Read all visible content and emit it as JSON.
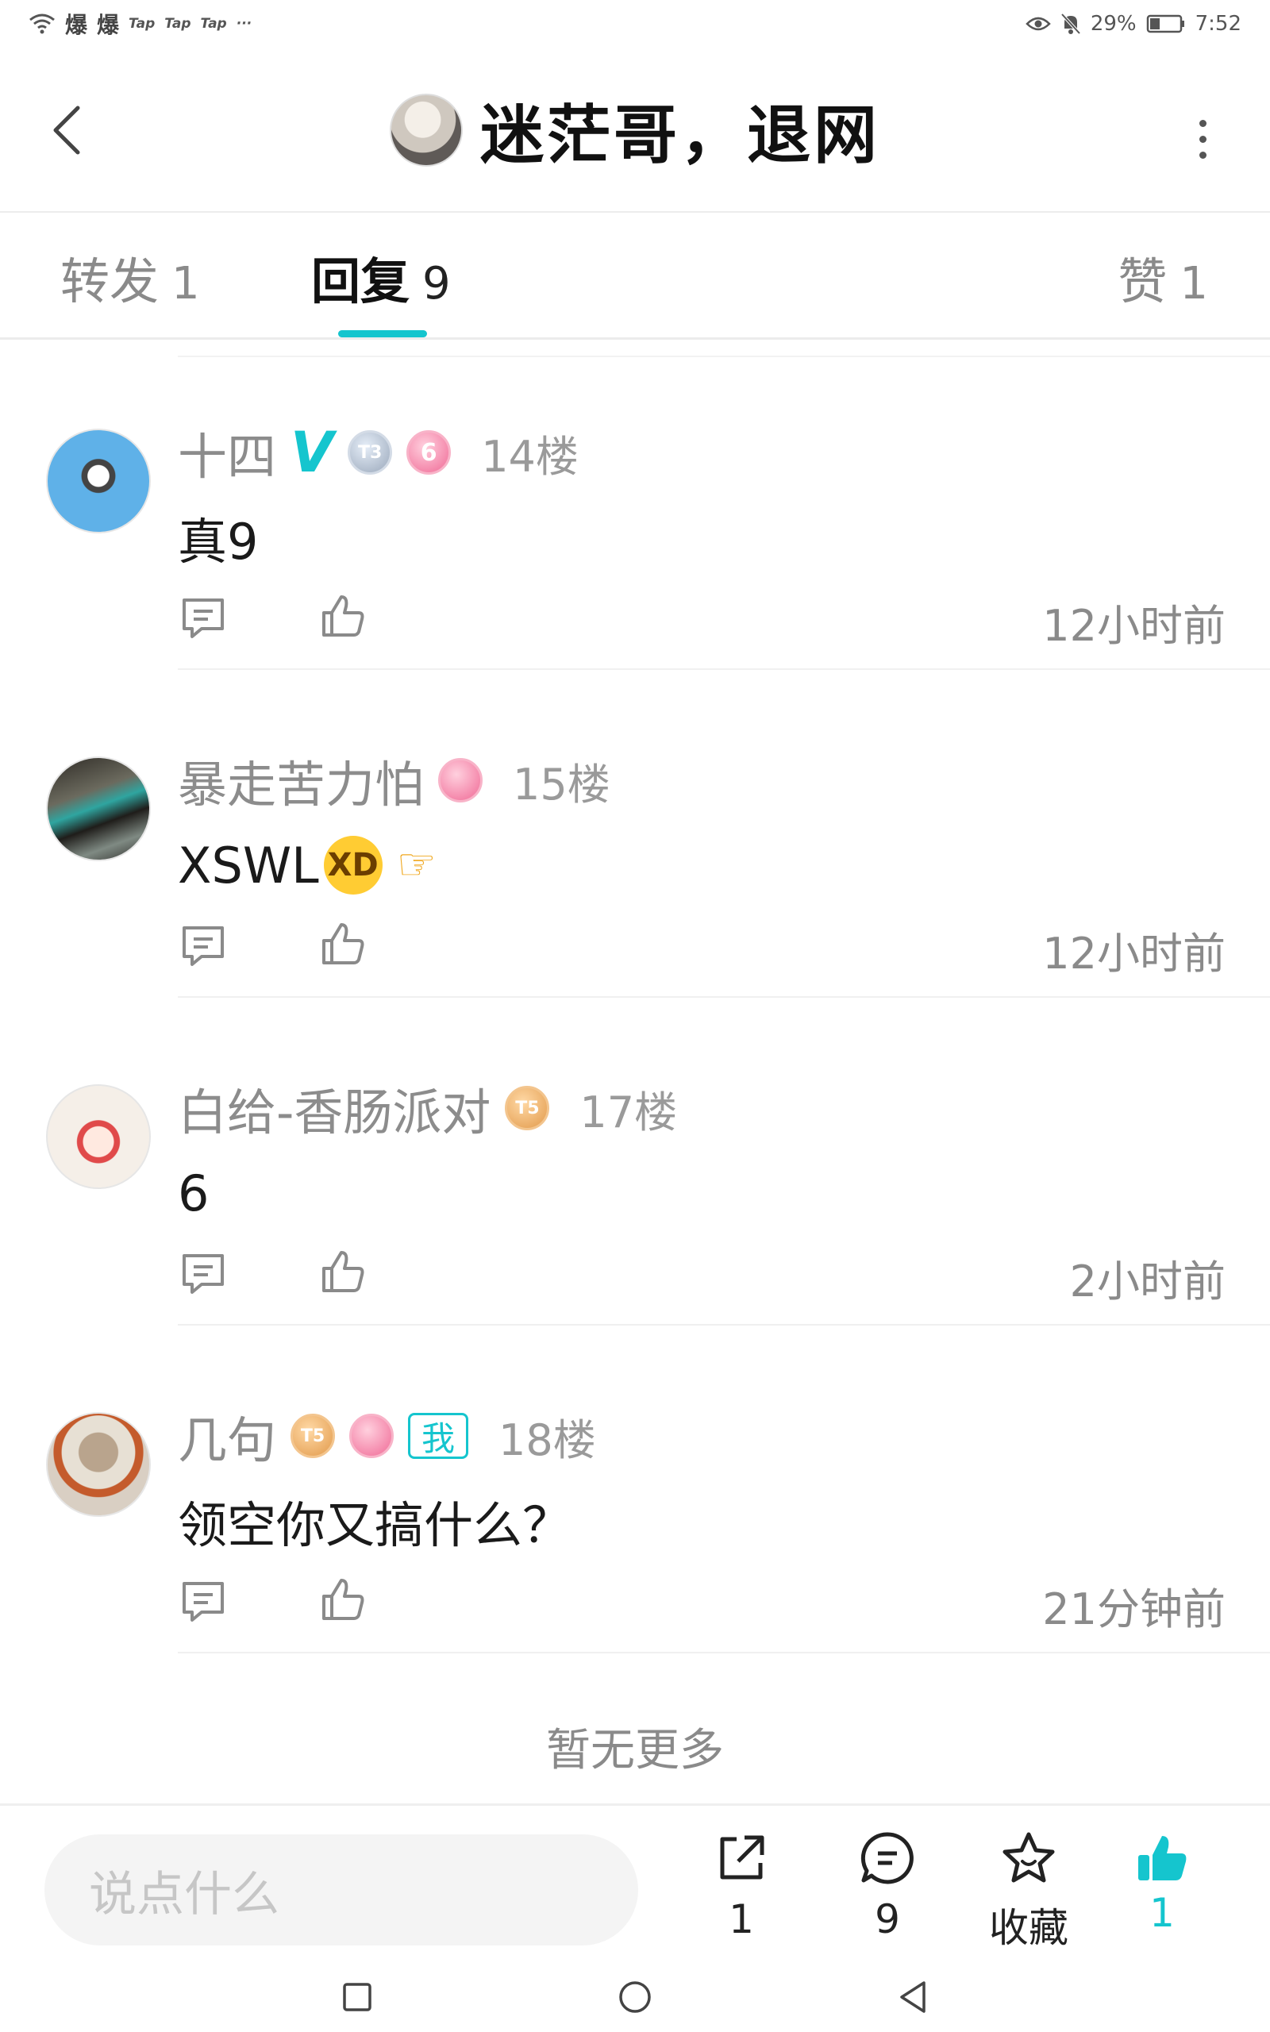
{
  "status_bar": {
    "app_icons": [
      "爆",
      "爆"
    ],
    "small_icons": [
      "Tap",
      "Tap",
      "Tap"
    ],
    "more": "···",
    "battery": "29%",
    "time": "7:52"
  },
  "header": {
    "title": "迷茫哥，退网"
  },
  "tabs": [
    {
      "label": "转发",
      "count": "1"
    },
    {
      "label": "回复",
      "count": "9"
    },
    {
      "label": "赞",
      "count": "1"
    }
  ],
  "comments": [
    {
      "user": "十四",
      "verified": "V",
      "badges": [
        "T3",
        "6"
      ],
      "floor": "14楼",
      "content": "真9",
      "time": "12小时前"
    },
    {
      "user": "暴走苦力怕",
      "badges": [
        "pink"
      ],
      "floor": "15楼",
      "content": "XSWL",
      "emojis": [
        "🤣",
        "👉"
      ],
      "time": "12小时前"
    },
    {
      "user": "白给-香肠派对",
      "badges": [
        "T5"
      ],
      "floor": "17楼",
      "content": "6",
      "time": "2小时前"
    },
    {
      "user": "几句",
      "badges": [
        "T5",
        "pink"
      ],
      "me_tag": "我",
      "floor": "18楼",
      "content": "领空你又搞什么？",
      "time": "21分钟前"
    }
  ],
  "no_more": "暂无更多",
  "bottom_bar": {
    "input_placeholder": "说点什么",
    "share_count": "1",
    "comment_count": "9",
    "favorite_label": "收藏",
    "like_count": "1"
  },
  "colors": {
    "accent": "#15c5ce",
    "text_primary": "#1a1a1a",
    "text_secondary": "#8a8a8a"
  }
}
